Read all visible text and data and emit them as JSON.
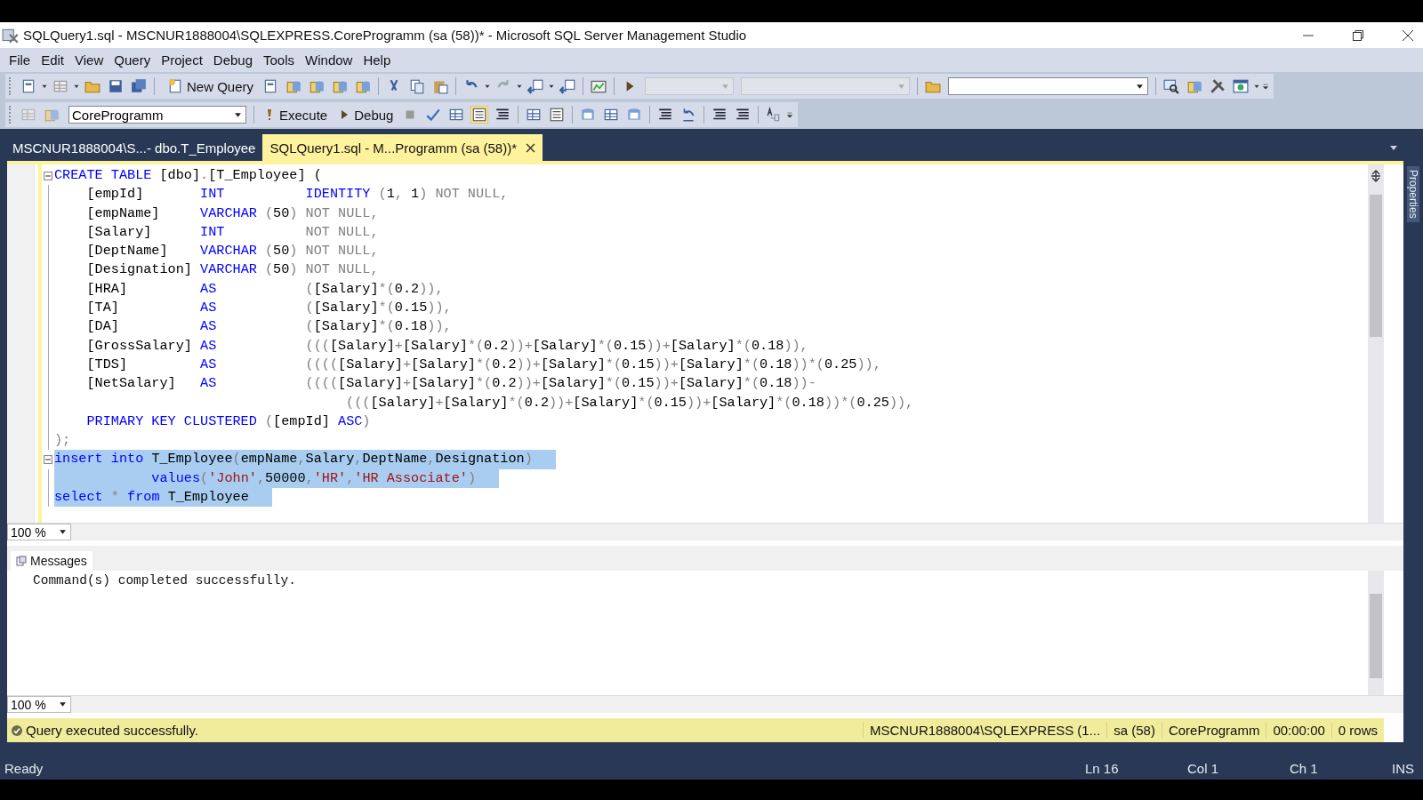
{
  "window": {
    "title": "SQLQuery1.sql - MSCNUR1888004\\SQLEXPRESS.CoreProgramm (sa (58))* - Microsoft SQL Server Management Studio"
  },
  "menu": [
    "File",
    "Edit",
    "View",
    "Query",
    "Project",
    "Debug",
    "Tools",
    "Window",
    "Help"
  ],
  "toolbar": {
    "new_query": "New Query"
  },
  "sql_toolbar": {
    "database": "CoreProgramm",
    "execute": "Execute",
    "debug": "Debug"
  },
  "tabs": [
    {
      "label": "MSCNUR1888004\\S...- dbo.T_Employee",
      "selected": false
    },
    {
      "label": "SQLQuery1.sql - M...Programm (sa (58))*",
      "selected": true
    }
  ],
  "side_panel": {
    "label": "Properties"
  },
  "editor": {
    "zoom": "100 %",
    "lines": [
      {
        "selected": false,
        "fold": true,
        "tokens": [
          {
            "kind": "kw",
            "text": "CREATE TABLE "
          },
          {
            "kind": "pl",
            "text": "[dbo]"
          },
          {
            "kind": "op",
            "text": "."
          },
          {
            "kind": "pl",
            "text": "[T_Employee] ("
          }
        ]
      },
      {
        "selected": false,
        "tokens": [
          {
            "kind": "pl",
            "text": "    [empId]       "
          },
          {
            "kind": "kw",
            "text": "INT          IDENTITY"
          },
          {
            "kind": "op",
            "text": " ("
          },
          {
            "kind": "pl",
            "text": "1"
          },
          {
            "kind": "op",
            "text": ", "
          },
          {
            "kind": "pl",
            "text": "1"
          },
          {
            "kind": "op",
            "text": ") NOT NULL,"
          }
        ]
      },
      {
        "selected": false,
        "tokens": [
          {
            "kind": "pl",
            "text": "    [empName]     "
          },
          {
            "kind": "kw",
            "text": "VARCHAR"
          },
          {
            "kind": "op",
            "text": " ("
          },
          {
            "kind": "pl",
            "text": "50"
          },
          {
            "kind": "op",
            "text": ") NOT NULL,"
          }
        ]
      },
      {
        "selected": false,
        "tokens": [
          {
            "kind": "pl",
            "text": "    [Salary]      "
          },
          {
            "kind": "kw",
            "text": "INT"
          },
          {
            "kind": "op",
            "text": "          NOT NULL,"
          }
        ]
      },
      {
        "selected": false,
        "tokens": [
          {
            "kind": "pl",
            "text": "    [DeptName]    "
          },
          {
            "kind": "kw",
            "text": "VARCHAR"
          },
          {
            "kind": "op",
            "text": " ("
          },
          {
            "kind": "pl",
            "text": "50"
          },
          {
            "kind": "op",
            "text": ") NOT NULL,"
          }
        ]
      },
      {
        "selected": false,
        "tokens": [
          {
            "kind": "pl",
            "text": "    [Designation] "
          },
          {
            "kind": "kw",
            "text": "VARCHAR"
          },
          {
            "kind": "op",
            "text": " ("
          },
          {
            "kind": "pl",
            "text": "50"
          },
          {
            "kind": "op",
            "text": ") NOT NULL,"
          }
        ]
      },
      {
        "selected": false,
        "tokens": [
          {
            "kind": "pl",
            "text": "    [HRA]         "
          },
          {
            "kind": "kw",
            "text": "AS"
          },
          {
            "kind": "op",
            "text": "           ("
          },
          {
            "kind": "pl",
            "text": "[Salary]"
          },
          {
            "kind": "op",
            "text": "*("
          },
          {
            "kind": "pl",
            "text": "0.2"
          },
          {
            "kind": "op",
            "text": ")),"
          }
        ]
      },
      {
        "selected": false,
        "tokens": [
          {
            "kind": "pl",
            "text": "    [TA]          "
          },
          {
            "kind": "kw",
            "text": "AS"
          },
          {
            "kind": "op",
            "text": "           ("
          },
          {
            "kind": "pl",
            "text": "[Salary]"
          },
          {
            "kind": "op",
            "text": "*("
          },
          {
            "kind": "pl",
            "text": "0.15"
          },
          {
            "kind": "op",
            "text": ")),"
          }
        ]
      },
      {
        "selected": false,
        "tokens": [
          {
            "kind": "pl",
            "text": "    [DA]          "
          },
          {
            "kind": "kw",
            "text": "AS"
          },
          {
            "kind": "op",
            "text": "           ("
          },
          {
            "kind": "pl",
            "text": "[Salary]"
          },
          {
            "kind": "op",
            "text": "*("
          },
          {
            "kind": "pl",
            "text": "0.18"
          },
          {
            "kind": "op",
            "text": ")),"
          }
        ]
      },
      {
        "selected": false,
        "tokens": [
          {
            "kind": "pl",
            "text": "    [GrossSalary] "
          },
          {
            "kind": "kw",
            "text": "AS"
          },
          {
            "kind": "op",
            "text": "           ((("
          },
          {
            "kind": "pl",
            "text": "[Salary]"
          },
          {
            "kind": "op",
            "text": "+"
          },
          {
            "kind": "pl",
            "text": "[Salary]"
          },
          {
            "kind": "op",
            "text": "*("
          },
          {
            "kind": "pl",
            "text": "0.2"
          },
          {
            "kind": "op",
            "text": "))+"
          },
          {
            "kind": "pl",
            "text": "[Salary]"
          },
          {
            "kind": "op",
            "text": "*("
          },
          {
            "kind": "pl",
            "text": "0.15"
          },
          {
            "kind": "op",
            "text": "))+"
          },
          {
            "kind": "pl",
            "text": "[Salary]"
          },
          {
            "kind": "op",
            "text": "*("
          },
          {
            "kind": "pl",
            "text": "0.18"
          },
          {
            "kind": "op",
            "text": ")),"
          }
        ]
      },
      {
        "selected": false,
        "tokens": [
          {
            "kind": "pl",
            "text": "    [TDS]         "
          },
          {
            "kind": "kw",
            "text": "AS"
          },
          {
            "kind": "op",
            "text": "           (((("
          },
          {
            "kind": "pl",
            "text": "[Salary]"
          },
          {
            "kind": "op",
            "text": "+"
          },
          {
            "kind": "pl",
            "text": "[Salary]"
          },
          {
            "kind": "op",
            "text": "*("
          },
          {
            "kind": "pl",
            "text": "0.2"
          },
          {
            "kind": "op",
            "text": "))+"
          },
          {
            "kind": "pl",
            "text": "[Salary]"
          },
          {
            "kind": "op",
            "text": "*("
          },
          {
            "kind": "pl",
            "text": "0.15"
          },
          {
            "kind": "op",
            "text": "))+"
          },
          {
            "kind": "pl",
            "text": "[Salary]"
          },
          {
            "kind": "op",
            "text": "*("
          },
          {
            "kind": "pl",
            "text": "0.18"
          },
          {
            "kind": "op",
            "text": "))*("
          },
          {
            "kind": "pl",
            "text": "0.25"
          },
          {
            "kind": "op",
            "text": ")),"
          }
        ]
      },
      {
        "selected": false,
        "tokens": [
          {
            "kind": "pl",
            "text": "    [NetSalary]   "
          },
          {
            "kind": "kw",
            "text": "AS"
          },
          {
            "kind": "op",
            "text": "           (((("
          },
          {
            "kind": "pl",
            "text": "[Salary]"
          },
          {
            "kind": "op",
            "text": "+"
          },
          {
            "kind": "pl",
            "text": "[Salary]"
          },
          {
            "kind": "op",
            "text": "*("
          },
          {
            "kind": "pl",
            "text": "0.2"
          },
          {
            "kind": "op",
            "text": "))+"
          },
          {
            "kind": "pl",
            "text": "[Salary]"
          },
          {
            "kind": "op",
            "text": "*("
          },
          {
            "kind": "pl",
            "text": "0.15"
          },
          {
            "kind": "op",
            "text": "))+"
          },
          {
            "kind": "pl",
            "text": "[Salary]"
          },
          {
            "kind": "op",
            "text": "*("
          },
          {
            "kind": "pl",
            "text": "0.18"
          },
          {
            "kind": "op",
            "text": "))-"
          }
        ]
      },
      {
        "selected": false,
        "tokens": [
          {
            "kind": "op",
            "text": "                                    ((("
          },
          {
            "kind": "pl",
            "text": "[Salary]"
          },
          {
            "kind": "op",
            "text": "+"
          },
          {
            "kind": "pl",
            "text": "[Salary]"
          },
          {
            "kind": "op",
            "text": "*("
          },
          {
            "kind": "pl",
            "text": "0.2"
          },
          {
            "kind": "op",
            "text": "))+"
          },
          {
            "kind": "pl",
            "text": "[Salary]"
          },
          {
            "kind": "op",
            "text": "*("
          },
          {
            "kind": "pl",
            "text": "0.15"
          },
          {
            "kind": "op",
            "text": "))+"
          },
          {
            "kind": "pl",
            "text": "[Salary]"
          },
          {
            "kind": "op",
            "text": "*("
          },
          {
            "kind": "pl",
            "text": "0.18"
          },
          {
            "kind": "op",
            "text": "))*("
          },
          {
            "kind": "pl",
            "text": "0.25"
          },
          {
            "kind": "op",
            "text": ")),"
          }
        ]
      },
      {
        "selected": false,
        "tokens": [
          {
            "kind": "kw",
            "text": "    PRIMARY KEY CLUSTERED"
          },
          {
            "kind": "op",
            "text": " ("
          },
          {
            "kind": "pl",
            "text": "[empId] "
          },
          {
            "kind": "kw",
            "text": "ASC"
          },
          {
            "kind": "op",
            "text": ")"
          }
        ]
      },
      {
        "selected": false,
        "tokens": [
          {
            "kind": "op",
            "text": ");"
          }
        ]
      },
      {
        "selected": true,
        "fold": true,
        "tokens": [
          {
            "kind": "kw",
            "text": "insert into "
          },
          {
            "kind": "pl",
            "text": "T_Employee"
          },
          {
            "kind": "op",
            "text": "("
          },
          {
            "kind": "pl",
            "text": "empName"
          },
          {
            "kind": "op",
            "text": ","
          },
          {
            "kind": "pl",
            "text": "Salary"
          },
          {
            "kind": "op",
            "text": ","
          },
          {
            "kind": "pl",
            "text": "DeptName"
          },
          {
            "kind": "op",
            "text": ","
          },
          {
            "kind": "pl",
            "text": "Designation"
          },
          {
            "kind": "op",
            "text": ")"
          }
        ]
      },
      {
        "selected": true,
        "tokens": [
          {
            "kind": "kw",
            "text": "            values"
          },
          {
            "kind": "op",
            "text": "("
          },
          {
            "kind": "str",
            "text": "'John'"
          },
          {
            "kind": "op",
            "text": ","
          },
          {
            "kind": "pl",
            "text": "50000"
          },
          {
            "kind": "op",
            "text": ","
          },
          {
            "kind": "str",
            "text": "'HR'"
          },
          {
            "kind": "op",
            "text": ","
          },
          {
            "kind": "str",
            "text": "'HR Associate'"
          },
          {
            "kind": "op",
            "text": ")"
          }
        ]
      },
      {
        "selected": true,
        "tokens": [
          {
            "kind": "kw",
            "text": "select "
          },
          {
            "kind": "op",
            "text": "* "
          },
          {
            "kind": "kw",
            "text": "from "
          },
          {
            "kind": "pl",
            "text": "T_Employee"
          }
        ]
      }
    ]
  },
  "results": {
    "tab": "Messages",
    "message": "Command(s) completed successfully.",
    "zoom": "100 %"
  },
  "query_status": {
    "message": "Query executed successfully.",
    "fields": [
      "MSCNUR1888004\\SQLEXPRESS (1...",
      "sa (58)",
      "CoreProgramm",
      "00:00:00",
      "0 rows"
    ]
  },
  "status_bar": {
    "state": "Ready",
    "line": "Ln 16",
    "column": "Col 1",
    "char": "Ch 1",
    "mode": "INS"
  }
}
